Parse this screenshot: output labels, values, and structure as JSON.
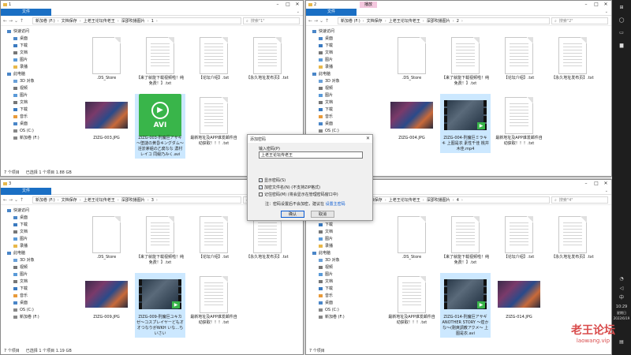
{
  "windows": [
    {
      "title": "1",
      "extra_tab": "",
      "path": [
        "新加卷 (F:)",
        "文档保存",
        "上老王论坛传老王",
        "深邵吹播图片",
        "1"
      ],
      "search_placeholder": "搜索\"1\"",
      "files": [
        {
          "kind": "doc",
          "name": ".DS_Store"
        },
        {
          "kind": "txt",
          "name": "【来了就能下载视频啦！纯免费！】.txt"
        },
        {
          "kind": "txt",
          "name": "【论坛介绍】.txt"
        },
        {
          "kind": "txt",
          "name": "【永久地址发布页】.txt"
        },
        {
          "kind": "img",
          "name": "ZIZG-003.JPG"
        },
        {
          "kind": "avi",
          "name": "ZIZG-003-刑魔巨アサギ～堕謎の黄昏キングダム～ 淫淤茅組の乙腐なな 濃村レイコ 同級乃みく.avi",
          "badge": "AVI"
        },
        {
          "kind": "txt",
          "name": "最新地址及APP谁发邮件自动获取！！！.txt"
        }
      ],
      "status": {
        "count": "7 个项目",
        "selected": "已选择 1 个项目  1.88 GB"
      }
    },
    {
      "title": "2",
      "extra_tab": "播放",
      "path": [
        "新加卷 (F:)",
        "文档保存",
        "上老王论坛传老王",
        "深邵吹播图片",
        "2"
      ],
      "search_placeholder": "搜索\"2\"",
      "files": [
        {
          "kind": "doc",
          "name": ".DS_Store"
        },
        {
          "kind": "txt",
          "name": "【来了就能下载视频啦！纯免费！】.txt"
        },
        {
          "kind": "txt",
          "name": "【论坛介绍】.txt"
        },
        {
          "kind": "txt",
          "name": "【永久地址发布页】.txt"
        },
        {
          "kind": "img",
          "name": "ZIZG-004.JPG"
        },
        {
          "kind": "vid",
          "name": "ZIZG-004-刑魔巨ミラキキ 上图是衣 素性千佳 桃井木佳.mp4"
        },
        {
          "kind": "txt",
          "name": "最新地址及APP谁发邮件自动获取！！！.txt"
        }
      ],
      "status": {
        "count": "7 个项目",
        "selected": "已选择 1 个项目"
      }
    },
    {
      "title": "3",
      "extra_tab": "",
      "path": [
        "新加卷 (F:)",
        "文档保存",
        "上老王论坛传老王",
        "深邵吹播图片",
        "3"
      ],
      "search_placeholder": "搜索\"3\"",
      "files": [
        {
          "kind": "doc",
          "name": ".DS_Store"
        },
        {
          "kind": "txt",
          "name": "【来了就能下载视频啦！纯免费！】.txt"
        },
        {
          "kind": "txt",
          "name": "【论坛介绍】.txt"
        },
        {
          "kind": "txt",
          "name": "【永久地址发布页】.txt"
        },
        {
          "kind": "img",
          "name": "ZIZG-009.JPG"
        },
        {
          "kind": "vid",
          "name": "ZIZG-009-刑魔巨ユキカゼ～コスプレイヤーどもオオつなりがWKH いな…ちいさい"
        },
        {
          "kind": "txt",
          "name": "最新地址及APP谁发邮件自动获取！！！.txt"
        }
      ],
      "status": {
        "count": "7 个项目",
        "selected": "已选择 1 个项目  1.19 GB"
      }
    },
    {
      "title": "4",
      "extra_tab": "",
      "path": [
        "新加卷 (F:)",
        "文档保存",
        "上老王论坛传老王",
        "深邵吹播图片",
        "4"
      ],
      "search_placeholder": "搜索\"4\"",
      "files": [
        {
          "kind": "doc",
          "name": ".DS_Store"
        },
        {
          "kind": "txt",
          "name": "【来了就能下载视频啦！纯免费！】.txt"
        },
        {
          "kind": "txt",
          "name": "【论坛介绍】.txt"
        },
        {
          "kind": "txt",
          "name": "【永久地址发布页】.txt"
        },
        {
          "kind": "txt",
          "name": "最新地址及APP谁发邮件自动获取！！！.txt"
        },
        {
          "kind": "vid",
          "name": "ZIZG-014-刑魔巨アサギ ANOTHER STORY ～煌かな～(剛爽調教アクメ～ 上图是衣.avi"
        },
        {
          "kind": "img",
          "name": "ZIZG-014.JPG"
        }
      ],
      "status": {
        "count": "7 个项目",
        "selected": ""
      }
    }
  ],
  "ribbon_tabs": [
    "文件",
    "主页",
    "共享",
    "查看"
  ],
  "nav": {
    "quick_access": "快速访问",
    "desktop": "桌面",
    "downloads": "下载",
    "documents": "文档",
    "pictures": "图片",
    "recordings": "录播",
    "this_pc": "此电脑",
    "objects3d": "3D 对象",
    "videos": "视频",
    "pictures2": "图片",
    "documents2": "文档",
    "downloads2": "下载",
    "music": "音乐",
    "desktop2": "桌面",
    "drive_c": "OS (C:)",
    "drive_f": "新加卷 (F:)"
  },
  "dialog": {
    "title": "添加密码",
    "label": "输入密码(P)",
    "value": "上老王论坛传老王",
    "opt_show": "显示密码(S)",
    "opt_encrypt_names": "加密文件名(N) (不支持ZIP格式)",
    "opt_remember": "记住密码(M) (将会显示在管理密码窗口中)",
    "note": "注：密码设置后不会加密，建议在",
    "note_link": "设置主密码",
    "ok": "确认",
    "cancel": "取消"
  },
  "taskbar": {
    "time": "10:29",
    "weekday": "星期日",
    "date": "2022/6/19",
    "ime": "中"
  },
  "watermark": {
    "line1": "老王论坛",
    "line2": "laowang.vip"
  },
  "colors": {
    "accent": "#1a6fc4",
    "selection": "#cce8ff",
    "video_badge": "#39b54a"
  }
}
